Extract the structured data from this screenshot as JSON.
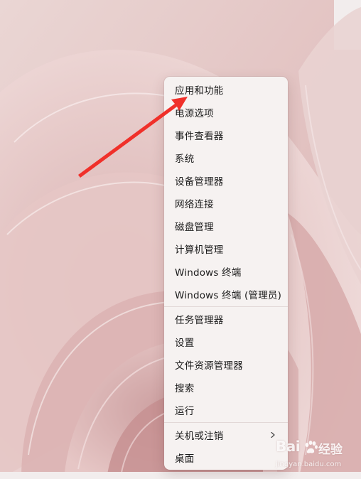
{
  "desktop": {
    "wallpaper": "windows-11-bloom-rose"
  },
  "menu": {
    "items": [
      {
        "label": "应用和功能"
      },
      {
        "label": "电源选项"
      },
      {
        "label": "事件查看器"
      },
      {
        "label": "系统"
      },
      {
        "label": "设备管理器"
      },
      {
        "label": "网络连接"
      },
      {
        "label": "磁盘管理"
      },
      {
        "label": "计算机管理"
      },
      {
        "label": "Windows 终端"
      },
      {
        "label": "Windows 终端 (管理员)"
      },
      {
        "label": "任务管理器"
      },
      {
        "label": "设置"
      },
      {
        "label": "文件资源管理器"
      },
      {
        "label": "搜索"
      },
      {
        "label": "运行"
      },
      {
        "label": "关机或注销",
        "submenu_icon": "chevron-right-icon"
      },
      {
        "label": "桌面"
      }
    ]
  },
  "annotation": {
    "arrow_color": "#f0302a"
  },
  "watermark": {
    "logo": "Bai",
    "brand": "经验",
    "url": "jingyan.baidu.com"
  }
}
